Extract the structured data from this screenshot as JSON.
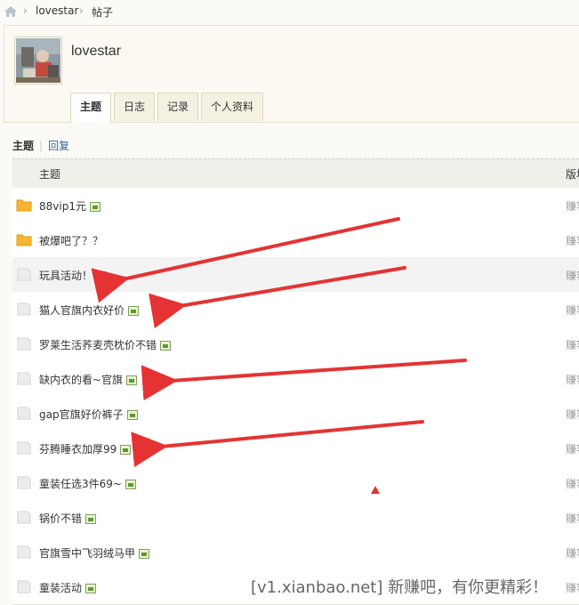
{
  "breadcrumb": {
    "home_icon": "home-icon",
    "items": [
      "lovestar",
      "帖子"
    ],
    "separator": "›"
  },
  "profile": {
    "username": "lovestar"
  },
  "tabs": [
    {
      "label": "主题",
      "active": true
    },
    {
      "label": "日志",
      "active": false
    },
    {
      "label": "记录",
      "active": false
    },
    {
      "label": "个人资料",
      "active": false
    }
  ],
  "subtabs": {
    "active": "主题",
    "other": "回复",
    "separator": "|"
  },
  "table": {
    "headers": [
      "主题",
      "版块"
    ],
    "rows": [
      {
        "title": "88vip1元",
        "icon": "folder-icon",
        "image": true,
        "board": "赚客"
      },
      {
        "title": "被爆吧了？？",
        "icon": "folder-icon",
        "image": false,
        "board": "赚客"
      },
      {
        "title": "玩具活动！",
        "icon": "doc-icon",
        "image": true,
        "board": "赚客"
      },
      {
        "title": "猫人官旗内衣好价",
        "icon": "doc-icon",
        "image": true,
        "board": "赚客"
      },
      {
        "title": "罗莱生活荞麦壳枕价不错",
        "icon": "doc-icon",
        "image": true,
        "board": "赚客"
      },
      {
        "title": "缺内衣的看~官旗",
        "icon": "doc-icon",
        "image": true,
        "board": "赚客"
      },
      {
        "title": "gap官旗好价裤子",
        "icon": "doc-icon",
        "image": true,
        "board": "赚客"
      },
      {
        "title": "芬腾睡衣加厚99",
        "icon": "doc-icon",
        "image": true,
        "board": "赚客"
      },
      {
        "title": "童装任选3件69~",
        "icon": "doc-icon",
        "image": true,
        "board": "赚客"
      },
      {
        "title": "锅价不错",
        "icon": "doc-icon",
        "image": true,
        "board": "赚客"
      },
      {
        "title": "官旗雪中飞羽绒马甲",
        "icon": "doc-icon",
        "image": true,
        "board": "赚客"
      },
      {
        "title": "童装活动",
        "icon": "doc-icon",
        "image": true,
        "board": "赚客"
      }
    ]
  },
  "watermark": "[v1.xianbao.net] 新赚吧，有你更精彩！",
  "colors": {
    "folder": "#f7b733",
    "arrow": "#e53333",
    "link": "#336699"
  }
}
